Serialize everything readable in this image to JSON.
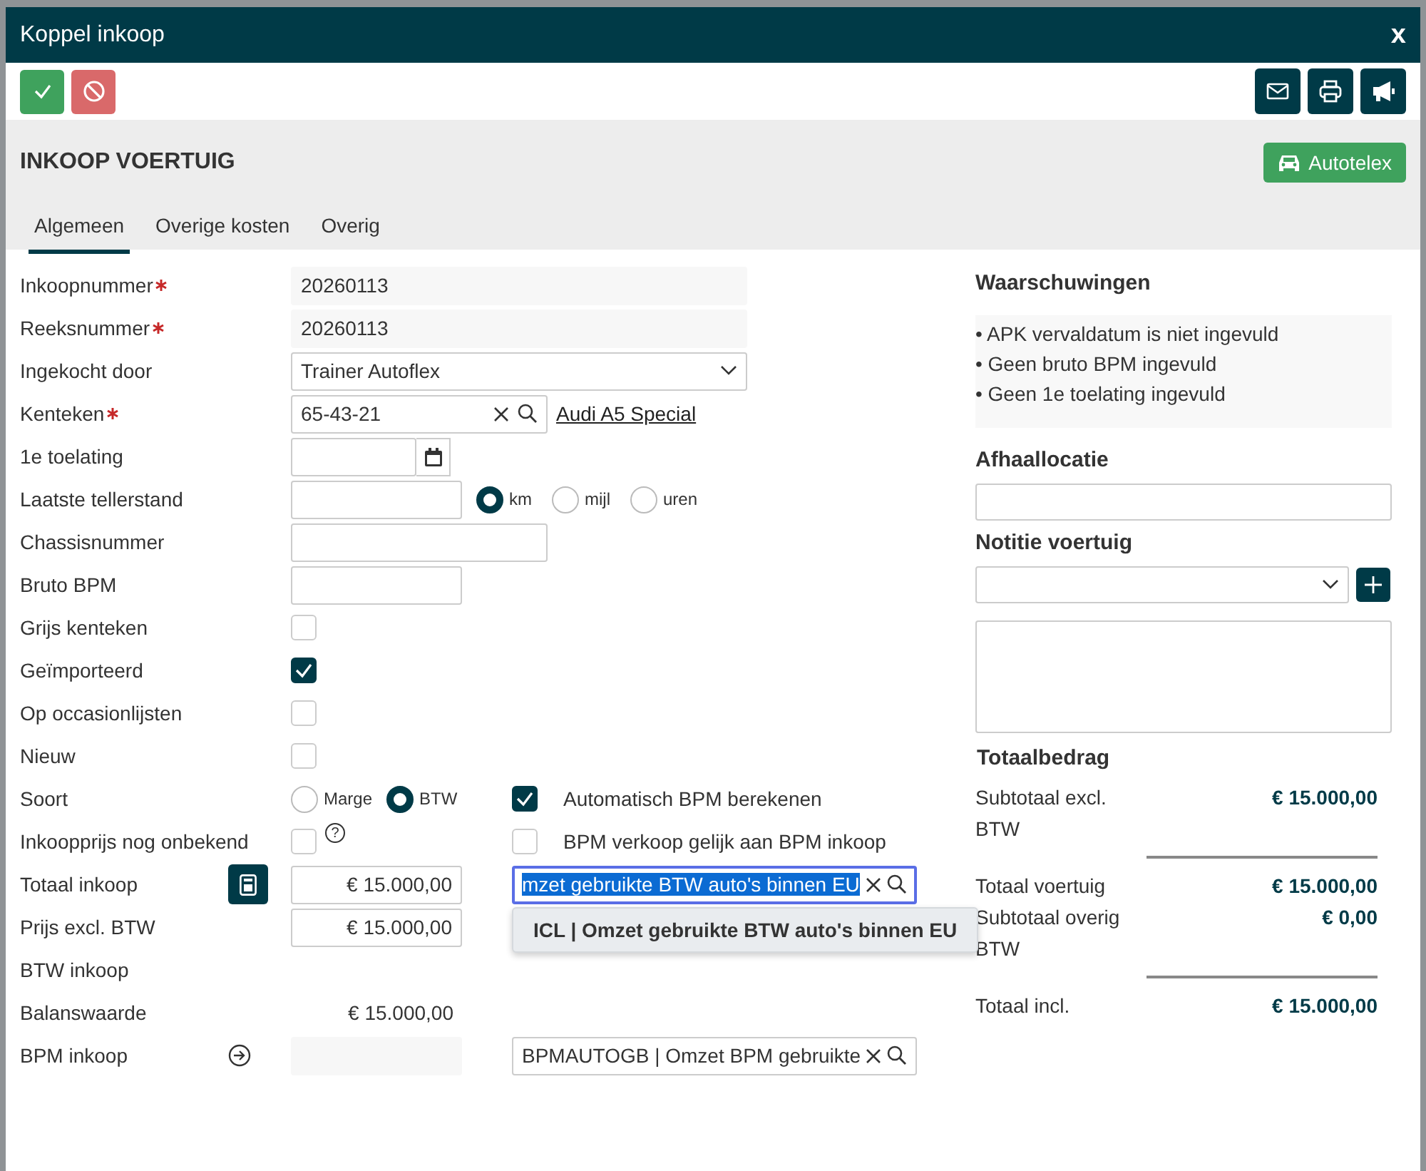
{
  "dialog": {
    "title": "Koppel inkoop",
    "close": "x"
  },
  "toolbar": {
    "left": [
      {
        "kind": "confirm"
      },
      {
        "kind": "cancel"
      }
    ],
    "right": [
      {
        "kind": "mail"
      },
      {
        "kind": "print"
      },
      {
        "kind": "announce"
      }
    ]
  },
  "header": {
    "title": "INKOOP VOERTUIG",
    "button": "Autotelex"
  },
  "tabs": [
    {
      "label": "Algemeen",
      "selected": true
    },
    {
      "label": "Overige kosten",
      "selected": false
    },
    {
      "label": "Overig",
      "selected": false
    }
  ],
  "form": {
    "rows": [
      {
        "label": "Inkoopnummer",
        "required": true,
        "field": {
          "kind": "readonly",
          "value": "20260113"
        }
      },
      {
        "label": "Reeksnummer",
        "required": true,
        "field": {
          "kind": "readonly",
          "value": "20260113"
        }
      },
      {
        "label": "Ingekocht door",
        "required": false,
        "field": {
          "kind": "select",
          "value": "Trainer Autoflex"
        }
      },
      {
        "label": "Kenteken",
        "required": true,
        "field": {
          "kind": "lookup",
          "value": "65-43-21",
          "link": "Audi A5 Special"
        }
      },
      {
        "label": "1e toelating",
        "required": false,
        "field": {
          "kind": "date"
        }
      },
      {
        "label": "Laatste tellerstand",
        "required": false,
        "field": {
          "kind": "input-radio",
          "options": [
            {
              "label": "km",
              "selected": true
            },
            {
              "label": "mijl",
              "selected": false
            },
            {
              "label": "uren",
              "selected": false
            }
          ]
        }
      },
      {
        "label": "Chassisnummer",
        "required": false,
        "field": {
          "kind": "text"
        }
      },
      {
        "label": "Bruto BPM",
        "required": false,
        "field": {
          "kind": "amount"
        }
      },
      {
        "label": "Grijs kenteken",
        "required": false,
        "field": {
          "kind": "checkbox",
          "checked": false
        }
      },
      {
        "label": "Geïmporteerd",
        "required": false,
        "field": {
          "kind": "checkbox",
          "checked": true
        }
      },
      {
        "label": "Op occasionlijsten",
        "required": false,
        "field": {
          "kind": "checkbox",
          "checked": false
        }
      },
      {
        "label": "Nieuw",
        "required": false,
        "field": {
          "kind": "checkbox",
          "checked": false
        }
      },
      {
        "label": "Soort",
        "required": false,
        "field": {
          "kind": "radio",
          "options": [
            {
              "label": "Marge",
              "selected": false
            },
            {
              "label": "BTW",
              "selected": true
            }
          ]
        },
        "extra": {
          "kind": "checkbox",
          "checked": true,
          "label": "Automatisch BPM berekenen"
        }
      },
      {
        "label": "Inkoopprijs nog onbekend",
        "required": false,
        "field": {
          "kind": "checkbox",
          "checked": false,
          "help": "?"
        },
        "extra": {
          "kind": "checkbox",
          "checked": false,
          "label": "BPM verkoop gelijk aan BPM inkoop"
        }
      },
      {
        "label": "Totaal inkoop",
        "required": false,
        "action": {
          "kind": "calculator"
        },
        "field": {
          "kind": "amount",
          "value": "€ 15.000,00"
        },
        "extra": {
          "kind": "lookup",
          "focused": true,
          "value": "mzet gebruikte BTW auto's binnen EU",
          "suggestion": "ICL | Omzet gebruikte BTW auto's binnen EU"
        }
      },
      {
        "label": "Prijs excl. BTW",
        "required": false,
        "field": {
          "kind": "amount",
          "value": "€ 15.000,00"
        }
      },
      {
        "label": "BTW inkoop",
        "required": false
      },
      {
        "label": "Balanswaarde",
        "required": false,
        "field": {
          "kind": "static",
          "value": "€ 15.000,00"
        }
      },
      {
        "label": "BPM inkoop",
        "required": false,
        "action": {
          "kind": "arrow"
        },
        "field": {
          "kind": "readonly-amount"
        },
        "extra": {
          "kind": "lookup",
          "focused": false,
          "value": "BPMAUTOGB | Omzet BPM gebruikte"
        }
      }
    ]
  },
  "side": {
    "warnings": {
      "title": "Waarschuwingen",
      "items": [
        "• APK vervaldatum is niet ingevuld",
        "• Geen bruto BPM ingevuld",
        "• Geen 1e toelating ingevuld"
      ]
    },
    "pickup": {
      "title": "Afhaallocatie"
    },
    "note": {
      "title": "Notitie voertuig"
    },
    "totals": {
      "title": "Totaalbedrag",
      "rows": [
        {
          "kind": "subtotal",
          "label": "Subtotaal excl. BTW",
          "value": "€ 15.000,00"
        },
        {
          "kind": "total",
          "label": "Totaal voertuig",
          "value": "€ 15.000,00"
        },
        {
          "kind": "subtotal",
          "label": "Subtotaal overig BTW",
          "value": "€ 0,00"
        },
        {
          "kind": "total",
          "label": "Totaal incl.",
          "value": "€ 15.000,00"
        }
      ]
    }
  }
}
